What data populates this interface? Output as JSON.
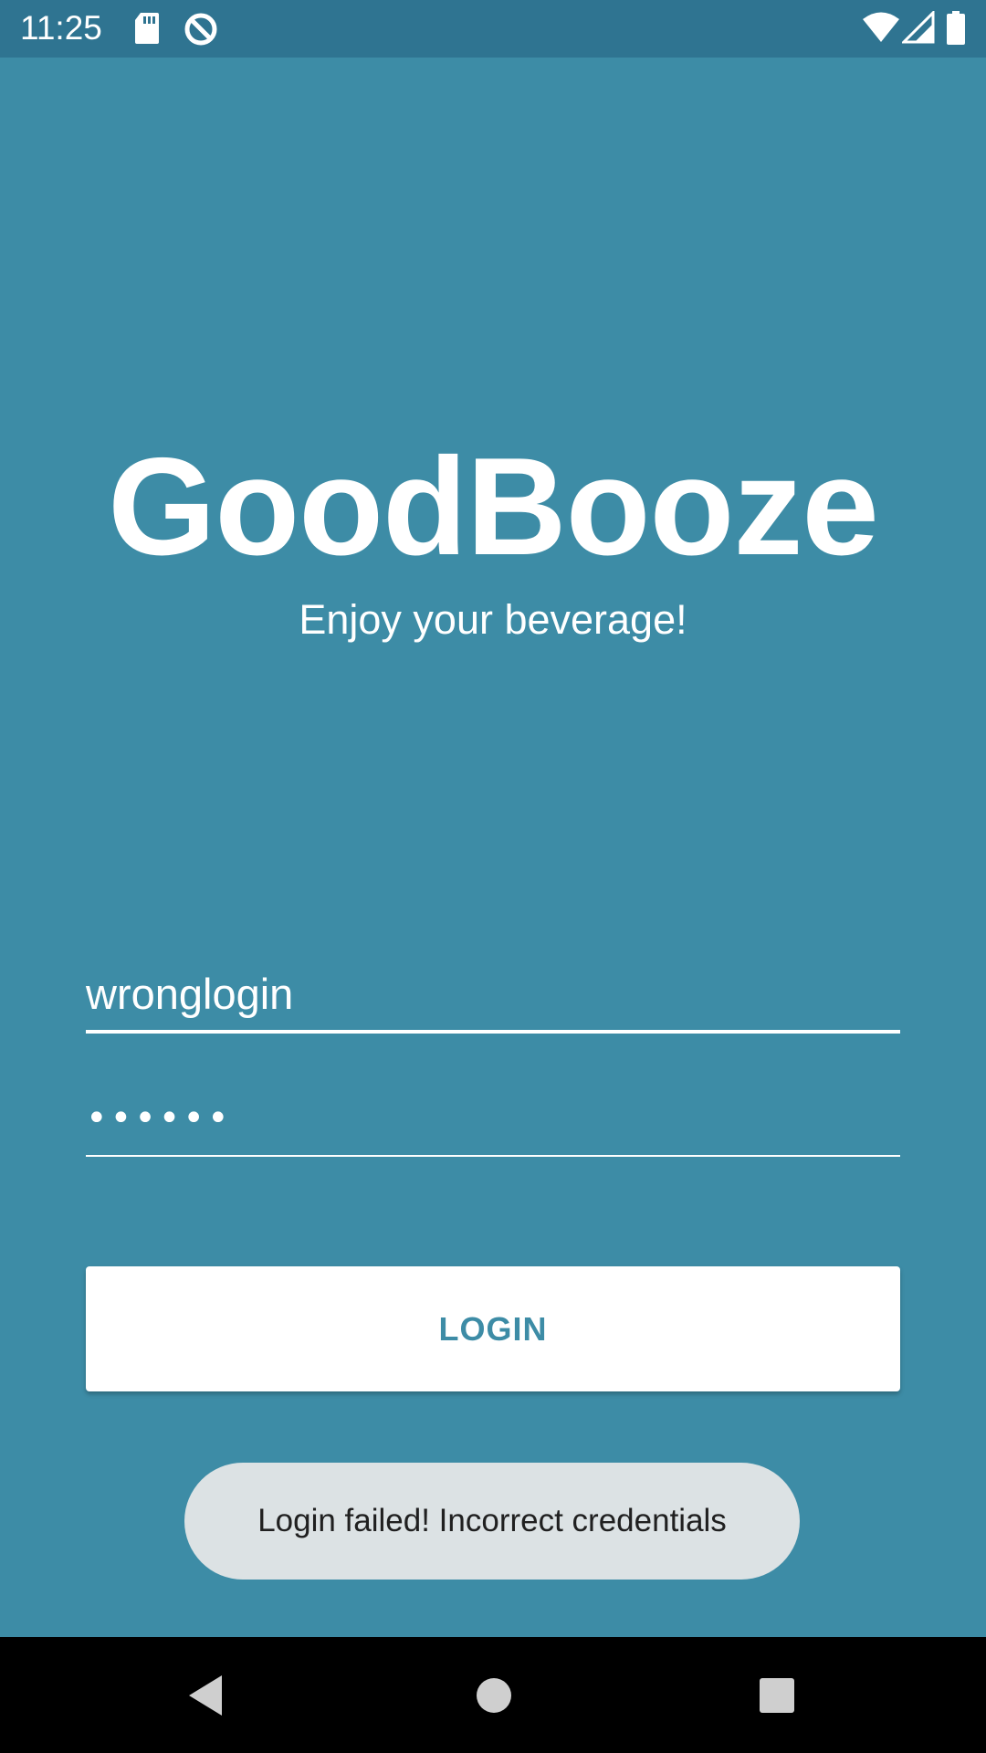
{
  "status_bar": {
    "time": "11:25",
    "icons": [
      "sd-card-icon",
      "sync-icon",
      "wifi-icon",
      "signal-icon",
      "battery-icon"
    ]
  },
  "header": {
    "title": "GoodBooze",
    "subtitle": "Enjoy your beverage!"
  },
  "form": {
    "login_value": "wronglogin",
    "password_value": "••••••"
  },
  "login_button": {
    "label": "LOGIN"
  },
  "toast": {
    "message": "Login failed! Incorrect credentials"
  },
  "nav_bar": {
    "icons": [
      "back-icon",
      "home-icon",
      "recents-icon"
    ]
  },
  "colors": {
    "background": "#3d8ca6",
    "status_bar": "#2f7491",
    "button_bg": "#ffffff",
    "button_text": "#3d8ca6",
    "toast_bg": "#dce2e4"
  }
}
